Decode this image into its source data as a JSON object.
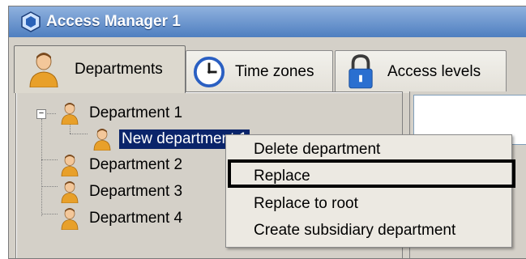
{
  "window": {
    "title": "Access Manager 1"
  },
  "tabs": [
    {
      "label": "Departments",
      "icon": "person-icon",
      "active": true
    },
    {
      "label": "Time zones",
      "icon": "clock-icon",
      "active": false
    },
    {
      "label": "Access levels",
      "icon": "padlock-icon",
      "active": false
    }
  ],
  "tree": {
    "root": {
      "label": "Department 1",
      "expanded": true
    },
    "child": {
      "label": "New department 1",
      "selected": true
    },
    "siblings": [
      {
        "label": "Department 2"
      },
      {
        "label": "Department 3"
      },
      {
        "label": "Department 4"
      }
    ]
  },
  "context_menu": {
    "items": [
      {
        "label": "Delete department"
      },
      {
        "label": "Replace",
        "highlighted": true
      },
      {
        "label": "Replace to root"
      },
      {
        "label": "Create subsidiary department"
      }
    ]
  },
  "colors": {
    "title_bar": "#4f7fc0",
    "selection": "#0a246a",
    "person_icon": "#e8a02a"
  }
}
